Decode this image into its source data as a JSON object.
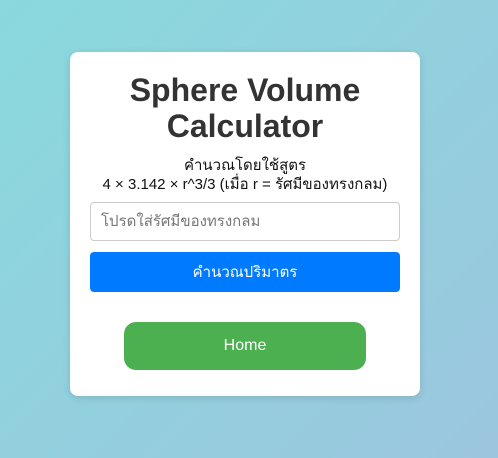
{
  "calculator": {
    "title_line1": "Sphere Volume",
    "title_line2": "Calculator",
    "formula_line1": "คำนวณโดยใช้สูตร",
    "formula_line2": "4 × 3.142 × r^3/3 (เมื่อ r = รัศมีของทรงกลม)",
    "radius_input": {
      "value": "",
      "placeholder": "โปรดใส่รัศมีของทรงกลม"
    },
    "calculate_label": "คำนวณปริมาตร",
    "result_text": ""
  },
  "navigation": {
    "home_label": "Home"
  },
  "colors": {
    "primary_button": "#007bff",
    "home_button": "#4caf50",
    "title_text": "#333333"
  }
}
